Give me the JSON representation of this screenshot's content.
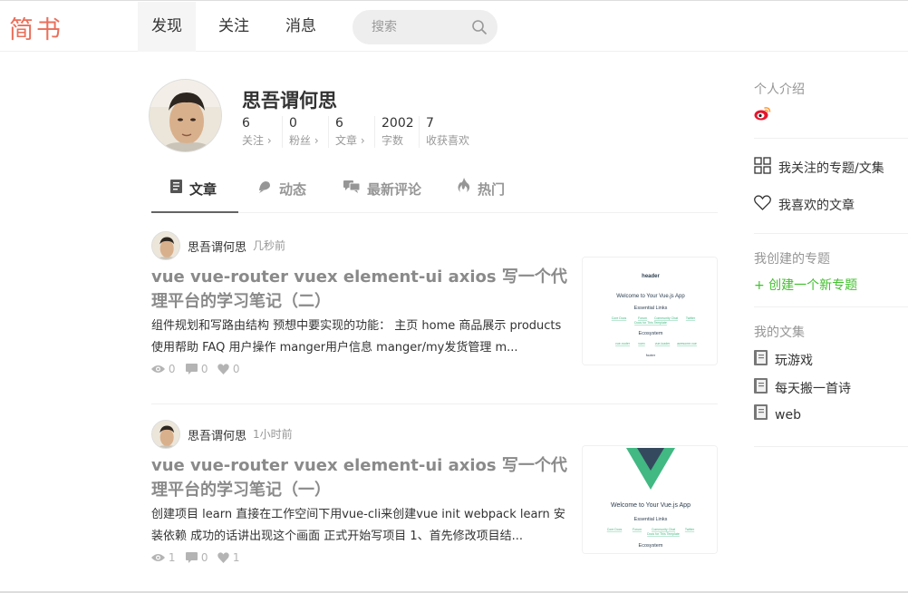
{
  "header": {
    "logo": "简书",
    "nav": [
      {
        "label": "发现"
      },
      {
        "label": "关注"
      },
      {
        "label": "消息"
      }
    ],
    "search": {
      "placeholder": "搜索"
    }
  },
  "profile": {
    "name": "思吾谓何思",
    "stats": [
      {
        "num": "6",
        "label": "关注 ›"
      },
      {
        "num": "0",
        "label": "粉丝 ›"
      },
      {
        "num": "6",
        "label": "文章 ›"
      },
      {
        "num": "2002",
        "label": "字数"
      },
      {
        "num": "7",
        "label": "收获喜欢"
      }
    ]
  },
  "tabs": [
    {
      "label": "文章",
      "icon": "article-icon"
    },
    {
      "label": "动态",
      "icon": "bell-icon"
    },
    {
      "label": "最新评论",
      "icon": "comments-icon"
    },
    {
      "label": "热门",
      "icon": "fire-icon"
    }
  ],
  "articles": [
    {
      "author": "思吾谓何思",
      "time": "几秒前",
      "title": "vue vue-router vuex element-ui axios 写一个代理平台的学习笔记（二）",
      "abstract": "组件规划和写路由结构 预想中要实现的功能： 主页 home 商品展示 products 使用帮助 FAQ 用户操作 manger用户信息 manger/my发货管理 m...",
      "views": "0",
      "comments": "0",
      "likes": "0",
      "thumb": {
        "header": "header",
        "welcome": "Welcome to Your Vue.js App",
        "essential": "Essential Links",
        "links1": [
          "Core Docs",
          "Forum",
          "Community Chat",
          "Twitter"
        ],
        "links2": "Docs for This Template",
        "ecosystem": "Ecosystem",
        "eco_links": [
          "vue-router",
          "vuex",
          "vue-loader",
          "awesome-vue"
        ],
        "footer": "footer"
      }
    },
    {
      "author": "思吾谓何思",
      "time": "1小时前",
      "title": "vue vue-router vuex element-ui axios 写一个代理平台的学习笔记（一）",
      "abstract": "创建项目 learn 直接在工作空间下用vue-cli来创建vue init webpack learn 安装依赖 成功的话讲出现这个画面 正式开始写项目 1、首先修改项目结...",
      "views": "1",
      "comments": "0",
      "likes": "1",
      "thumb": {
        "welcome": "Welcome to Your Vue.js App",
        "essential": "Essential Links",
        "links1": [
          "Core Docs",
          "Forum",
          "Community Chat",
          "Twitter"
        ],
        "links2": "Docs for This Template",
        "ecosystem": "Ecosystem"
      }
    }
  ],
  "sidebar": {
    "intro_label": "个人介绍",
    "followed_label": "我关注的专题/文集",
    "liked_label": "我喜欢的文章",
    "created_label": "我创建的专题",
    "create_new": "+ 创建一个新专题",
    "notebooks_label": "我的文集",
    "notebooks": [
      "玩游戏",
      "每天搬一首诗",
      "web"
    ]
  },
  "colors": {
    "brand": "#ea6f5a",
    "green": "#42c02e",
    "vue_green": "#42b883",
    "vue_dark": "#35495e"
  }
}
